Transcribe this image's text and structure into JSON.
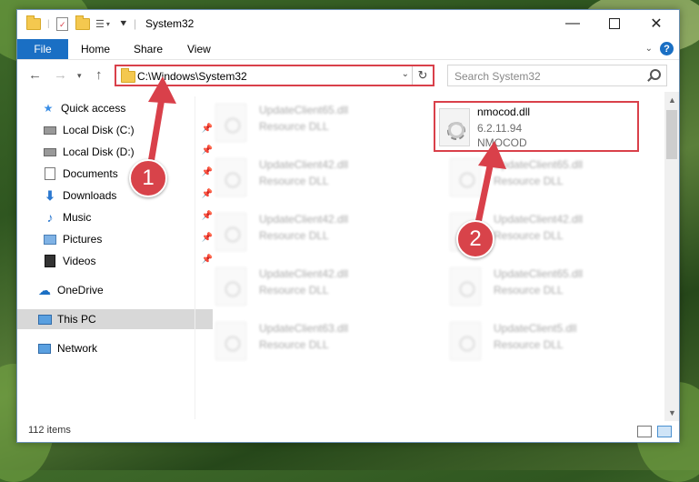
{
  "window": {
    "title": "System32"
  },
  "ribbon": {
    "tabs": [
      "File",
      "Home",
      "Share",
      "View"
    ],
    "help_label": "?"
  },
  "nav": {
    "address": "C:\\Windows\\System32",
    "search_placeholder": "Search System32"
  },
  "sidebar": {
    "items": [
      {
        "label": "Quick access",
        "icon": "star-icon"
      },
      {
        "label": "Local Disk (C:)",
        "icon": "drive-icon",
        "pinned": true
      },
      {
        "label": "Local Disk (D:)",
        "icon": "drive-icon",
        "pinned": true
      },
      {
        "label": "Documents",
        "icon": "documents-icon",
        "pinned": true
      },
      {
        "label": "Downloads",
        "icon": "download-icon",
        "pinned": true
      },
      {
        "label": "Music",
        "icon": "music-icon",
        "pinned": true
      },
      {
        "label": "Pictures",
        "icon": "pictures-icon",
        "pinned": true
      },
      {
        "label": "Videos",
        "icon": "videos-icon",
        "pinned": true
      },
      {
        "label": "OneDrive",
        "icon": "cloud-icon"
      },
      {
        "label": "This PC",
        "icon": "computer-icon",
        "selected": true
      },
      {
        "label": "Network",
        "icon": "network-icon"
      }
    ]
  },
  "files": {
    "highlighted": {
      "name": "nmocod.dll",
      "version": "6.2.11.94",
      "description": "NMOCOD"
    },
    "blurred": [
      {
        "name": "UpdateClient65.dll",
        "type": "Resource DLL"
      },
      {
        "name": "UpdateClient42.dll",
        "type": "Resource DLL"
      },
      {
        "name": "UpdateClient65.dll",
        "type": "Resource DLL"
      },
      {
        "name": "UpdateClient42.dll",
        "type": "Resource DLL"
      },
      {
        "name": "UpdateClient42.dll",
        "type": "Resource DLL"
      },
      {
        "name": "UpdateClient42.dll",
        "type": "Resource DLL"
      },
      {
        "name": "UpdateClient65.dll",
        "type": "Resource DLL"
      },
      {
        "name": "UpdateClient63.dll",
        "type": "Resource DLL"
      },
      {
        "name": "UpdateClient5.dll",
        "type": "Resource DLL"
      }
    ]
  },
  "status": {
    "item_count": "112 items"
  },
  "callouts": {
    "one": "1",
    "two": "2"
  },
  "colors": {
    "accent": "#1a6fc4",
    "highlight": "#d9404a"
  }
}
